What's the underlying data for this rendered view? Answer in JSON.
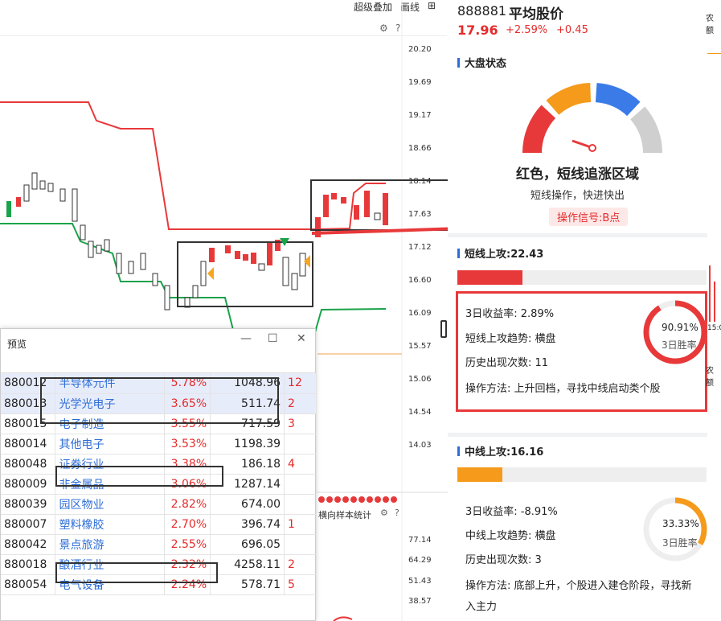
{
  "toolbar": {
    "overlay_label": "超级叠加",
    "draw_label": "画线"
  },
  "price_axis": [
    "20.20",
    "19.69",
    "19.17",
    "18.66",
    "18.14",
    "17.63",
    "17.12",
    "16.60",
    "16.09",
    "15.57",
    "15.06",
    "14.54",
    "14.03"
  ],
  "sub_axis": [
    "77.14",
    "64.29",
    "51.43",
    "38.57"
  ],
  "sub_label": "横向样本统计",
  "header": {
    "code": "888881",
    "name": "平均股价",
    "price": "17.96",
    "change_pct": "+2.59%",
    "change": "+0.45"
  },
  "market": {
    "title": "大盘状态",
    "state": "红色，短线追涨区域",
    "advice": "短线操作，快进快出",
    "signal": "操作信号:B点",
    "gauge_colors": [
      "#e8393a",
      "#f59a1b",
      "#3a7be8",
      "#cfcfcf"
    ]
  },
  "short": {
    "title": "短线上攻:22.43",
    "fill": 0.262,
    "color": "#e8393a",
    "ret_label": "3日收益率:  2.89%",
    "trend_label": "短线上攻趋势:  横盘",
    "count_label": "历史出现次数:  11",
    "method_label": "操作方法:  上升回档，寻找中线启动类个股",
    "winrate": "90.91%",
    "winrate_frac": 0.9091,
    "winrate_label": "3日胜率"
  },
  "mid": {
    "title": "中线上攻:16.16",
    "fill": 0.18,
    "color": "#f59a1b",
    "ret_label": "3日收益率:  -8.91%",
    "trend_label": "中线上攻趋势:  横盘",
    "count_label": "历史出现次数:  3",
    "method_label": "操作方法:  底部上升，个股进入建仓阶段，寻找新",
    "method_label2": "入主力",
    "winrate": "33.33%",
    "winrate_frac": 0.3333,
    "winrate_label": "3日胜率"
  },
  "preview": {
    "title": "预览",
    "rows": [
      {
        "code": "880012",
        "name": "半导体元件",
        "pct": "5.78%",
        "val": "1048.96",
        "ex": "12"
      },
      {
        "code": "880013",
        "name": "光学光电子",
        "pct": "3.65%",
        "val": "511.74",
        "ex": "2"
      },
      {
        "code": "880015",
        "name": "电子制造",
        "pct": "3.55%",
        "val": "717.59",
        "ex": "3"
      },
      {
        "code": "880014",
        "name": "其他电子",
        "pct": "3.53%",
        "val": "1198.39",
        "ex": ""
      },
      {
        "code": "880048",
        "name": "证券行业",
        "pct": "3.38%",
        "val": "186.18",
        "ex": "4"
      },
      {
        "code": "880009",
        "name": "非金属品",
        "pct": "3.06%",
        "val": "1287.14",
        "ex": ""
      },
      {
        "code": "880039",
        "name": "园区物业",
        "pct": "2.82%",
        "val": "674.00",
        "ex": ""
      },
      {
        "code": "880007",
        "name": "塑料橡胶",
        "pct": "2.70%",
        "val": "396.74",
        "ex": "1"
      },
      {
        "code": "880042",
        "name": "景点旅游",
        "pct": "2.55%",
        "val": "696.05",
        "ex": ""
      },
      {
        "code": "880018",
        "name": "酿酒行业",
        "pct": "2.32%",
        "val": "4258.11",
        "ex": "2"
      },
      {
        "code": "880054",
        "name": "电气设备",
        "pct": "2.24%",
        "val": "578.71",
        "ex": "5"
      }
    ]
  },
  "far_right": {
    "label1": "农额",
    "label2": "农额",
    "time": "15:0"
  }
}
